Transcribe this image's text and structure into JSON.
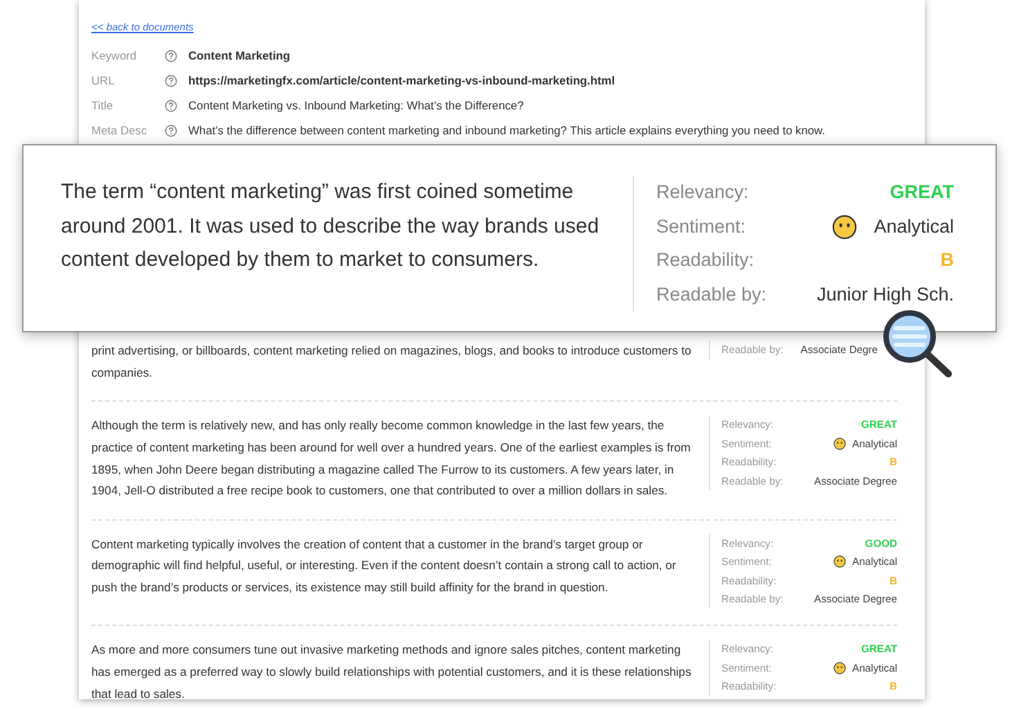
{
  "back_link": "<< back to documents",
  "fields": [
    {
      "label": "Keyword",
      "value": "Content Marketing",
      "bold": true
    },
    {
      "label": "URL",
      "value": "https://marketingfx.com/article/content-marketing-vs-inbound-marketing.html",
      "bold": true
    },
    {
      "label": "Title",
      "value": "Content Marketing vs. Inbound Marketing: What’s the Difference?",
      "bold": false
    },
    {
      "label": "Meta Desc",
      "value": "What’s the difference between content marketing and inbound marketing? This article explains everything you need to know.",
      "bold": false
    }
  ],
  "highlight": {
    "text": "The term “content marketing” was first coined sometime around 2001. It was used to describe the way brands used content developed by them to market to consumers.",
    "metrics": [
      {
        "kind": "rating",
        "label": "Relevancy:",
        "value": "GREAT",
        "color": "#2fd14f"
      },
      {
        "kind": "sentiment",
        "label": "Sentiment:",
        "value": "Analytical"
      },
      {
        "kind": "rating",
        "label": "Readability:",
        "value": "B",
        "color": "#f9b52a"
      },
      {
        "kind": "text",
        "label": "Readable by:",
        "value": "Junior High Sch."
      }
    ]
  },
  "paragraphs": [
    {
      "text": "print advertising, or billboards, content marketing relied on magazines, blogs, and books to introduce customers to companies.",
      "metrics": [
        {
          "kind": "text",
          "label": "Readable by:",
          "value": "Associate Degre"
        }
      ]
    },
    {
      "text": "Although the term is relatively new, and has only really become common knowledge in the last few years, the practice of content marketing has been around for well over a hundred years. One of the earliest examples is from 1895, when John Deere began distributing a magazine called The Furrow to its customers. A few years later, in 1904, Jell-O distributed a free recipe book to customers, one that contributed to over a million dollars in sales.",
      "metrics": [
        {
          "kind": "rating",
          "label": "Relevancy:",
          "value": "GREAT",
          "color": "#2fd14f"
        },
        {
          "kind": "sentiment",
          "label": "Sentiment:",
          "value": "Analytical"
        },
        {
          "kind": "rating",
          "label": "Readability:",
          "value": "B",
          "color": "#f9b52a"
        },
        {
          "kind": "text",
          "label": "Readable by:",
          "value": "Associate Degree"
        }
      ]
    },
    {
      "text": "Content marketing typically involves the creation of content that a customer in the brand’s target group or demographic will find helpful, useful, or interesting. Even if the content doesn’t contain a strong call to action, or push the brand’s products or services, its existence may still build affinity for the brand in question.",
      "metrics": [
        {
          "kind": "rating",
          "label": "Relevancy:",
          "value": "GOOD",
          "color": "#2fd14f"
        },
        {
          "kind": "sentiment",
          "label": "Sentiment:",
          "value": "Analytical"
        },
        {
          "kind": "rating",
          "label": "Readability:",
          "value": "B",
          "color": "#f9b52a"
        },
        {
          "kind": "text",
          "label": "Readable by:",
          "value": "Associate Degree"
        }
      ]
    },
    {
      "text": "As more and more consumers tune out invasive marketing methods and ignore sales pitches, content marketing has emerged as a preferred way to slowly build relationships with potential customers, and it is these relationships that lead to sales.",
      "metrics": [
        {
          "kind": "rating",
          "label": "Relevancy:",
          "value": "GREAT",
          "color": "#2fd14f"
        },
        {
          "kind": "sentiment",
          "label": "Sentiment:",
          "value": "Analytical"
        },
        {
          "kind": "rating",
          "label": "Readability:",
          "value": "B",
          "color": "#f9b52a"
        }
      ]
    }
  ]
}
